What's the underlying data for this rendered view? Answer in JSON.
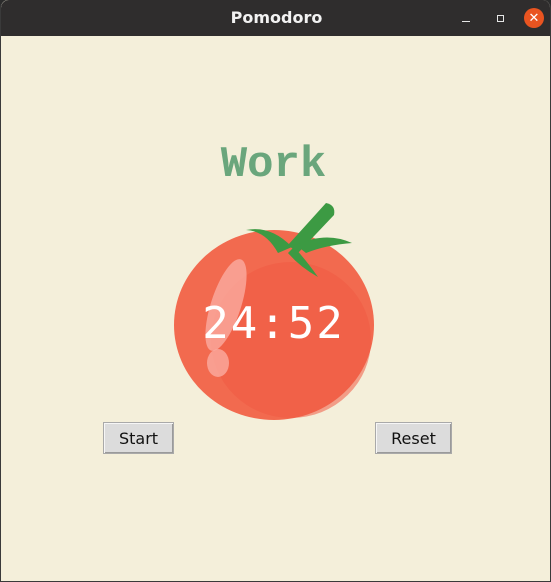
{
  "window": {
    "title": "Pomodoro"
  },
  "window_controls": {
    "minimize_icon": "minimize-icon",
    "maximize_icon": "maximize-icon",
    "close_icon": "close-icon",
    "close_glyph": "✕"
  },
  "main": {
    "heading": "Work",
    "timer": "24:52",
    "image_icon": "tomato-image"
  },
  "buttons": {
    "start_label": "Start",
    "reset_label": "Reset"
  },
  "colors": {
    "background": "#f4efda",
    "heading": "#6aa67c",
    "tomato": "#f26a4f",
    "leaf": "#3c9a43",
    "close_button": "#e95420"
  }
}
